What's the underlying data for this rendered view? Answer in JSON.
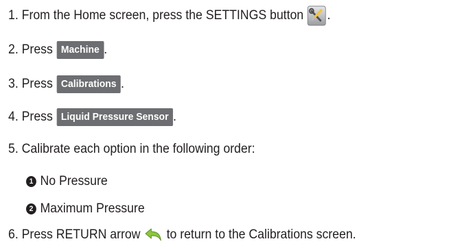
{
  "steps": [
    {
      "prefix": "1. From the Home screen, press the SETTINGS button",
      "suffix": "."
    },
    {
      "prefix": "2. Press",
      "button": "Machine",
      "suffix": "."
    },
    {
      "prefix": "3. Press",
      "button": "Calibrations",
      "suffix": "."
    },
    {
      "prefix": "4. Press",
      "button": "Liquid Pressure Sensor",
      "suffix": "."
    },
    {
      "text": "5. Calibrate each option in the following order:"
    },
    {
      "prefix": "6. Press RETURN arrow",
      "suffix": "to return to the Calibrations screen."
    }
  ],
  "suboptions": [
    {
      "marker": "1",
      "label": "No Pressure"
    },
    {
      "marker": "2",
      "label": "Maximum Pressure"
    }
  ],
  "icons": {
    "settings": "settings-icon",
    "return": "return-arrow-icon"
  },
  "colors": {
    "button_bg": "#6d6e71",
    "text": "#231f20",
    "return_arrow": "#8dc63f"
  }
}
